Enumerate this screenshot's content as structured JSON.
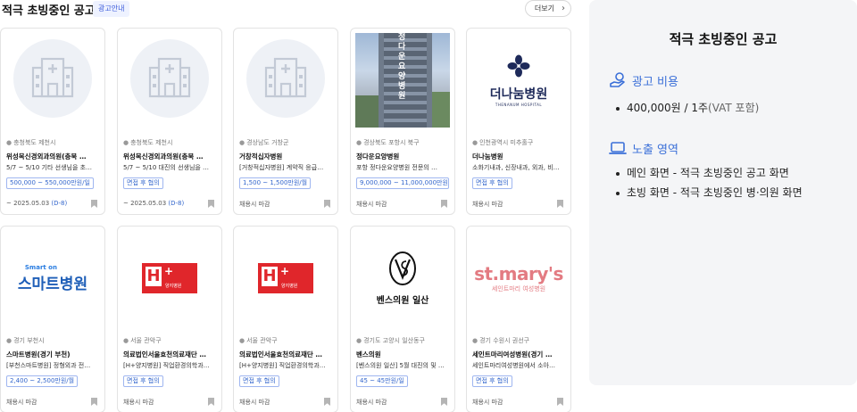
{
  "header": {
    "title": "적극 초빙중인 공고",
    "ad_badge": "광고안내",
    "more_label": "더보기"
  },
  "cards": [
    {
      "thumb": "hospital-placeholder",
      "location": "충청북도 제천시",
      "name": "위성목신경외과의원(충북 …",
      "desc": "5/7 ~ 5/10 기타 선생님을 초…",
      "pay": "500,000 ~ 550,000만원/일",
      "deadline": "~ 2025.05.03",
      "dday": "(D-8)"
    },
    {
      "thumb": "hospital-placeholder",
      "location": "충청북도 제천시",
      "name": "위성목신경외과의원(충북 …",
      "desc": "5/7 ~ 5/10 대진의 선생님을 …",
      "pay": "면접 후 협의",
      "deadline": "~ 2025.05.03",
      "dday": "(D-8)"
    },
    {
      "thumb": "hospital-placeholder",
      "location": "경상남도 거창군",
      "name": "거창적십자병원",
      "desc": "[거창적십자병원] 계약직 응급…",
      "pay": "1,500 ~ 1,500만원/월",
      "deadline": "채용시 마감",
      "dday": ""
    },
    {
      "thumb": "building-photo",
      "thumb_text": "정다운요양병원",
      "location": "경상북도 포항시 북구",
      "name": "정다운요양병원",
      "desc": "포항 정다운요양병원 전문의 …",
      "pay": "9,000,000 ~ 11,000,000만원/월",
      "deadline": "채용시 마감",
      "dday": ""
    },
    {
      "thumb": "thenanum-logo",
      "thumb_text": "더나눔병원",
      "thumb_sub": "THENANUM HOSPITAL",
      "location": "인천광역시 미추홀구",
      "name": "더나눔병원",
      "desc": "소화기내과, 신장내과, 외과, 비…",
      "pay": "면접 후 협의",
      "deadline": "채용시 마감",
      "dday": ""
    },
    {
      "thumb": "smarton-logo",
      "thumb_text": "스마트병원",
      "thumb_sub": "Smart on",
      "location": "경기 부천시",
      "name": "스마트병원(경기 부천)",
      "desc": "[부천스마트병원] 정형외과 전…",
      "pay": "2,400 ~ 2,500만원/월",
      "deadline": "채용시 마감",
      "dday": ""
    },
    {
      "thumb": "h-plus-logo",
      "thumb_text": "H",
      "thumb_sub": "양지병원",
      "location": "서울 관악구",
      "name": "의료법인서울효천의료재단 …",
      "desc": "[H+양지병원] 직업환경의학과…",
      "pay": "면접 후 협의",
      "deadline": "채용시 마감",
      "dday": ""
    },
    {
      "thumb": "h-plus-logo",
      "thumb_text": "H",
      "thumb_sub": "양지병원",
      "location": "서울 관악구",
      "name": "의료법인서울효천의료재단 …",
      "desc": "[H+양지병원] 직업환경의학과…",
      "pay": "면접 후 협의",
      "deadline": "채용시 마감",
      "dday": ""
    },
    {
      "thumb": "vence-logo",
      "thumb_text": "벤스의원 일산",
      "location": "경기도 고양시 일산동구",
      "name": "벤스의원",
      "desc": "[벤스의원 일산] 5월 대진의 및 …",
      "pay": "45 ~ 45만원/일",
      "deadline": "채용시 마감",
      "dday": ""
    },
    {
      "thumb": "stmarys-logo",
      "thumb_text": "st.mary's",
      "thumb_sub": "세인트마리 여성병원",
      "location": "경기 수원시 권선구",
      "name": "세인트마리여성병원(경기 …",
      "desc": "세인트마리여성병원에서 소아…",
      "pay": "면접 후 협의",
      "deadline": "채용시 마감",
      "dday": ""
    }
  ],
  "side": {
    "title": "적극 초빙중인 공고",
    "cost_heading": "광고 비용",
    "cost_item_main": "400,000원 / 1주",
    "cost_item_note": "(VAT 포함)",
    "area_heading": "노출 영역",
    "area_items": [
      "메인 화면 - 적극 초빙중인 공고 화면",
      "초빙 화면 - 적극 초빙중인 병·의원 화면"
    ]
  },
  "colors": {
    "accent": "#3a6fd8",
    "pay_border": "#9fb6f0",
    "panel_bg": "#f4f5f7"
  }
}
